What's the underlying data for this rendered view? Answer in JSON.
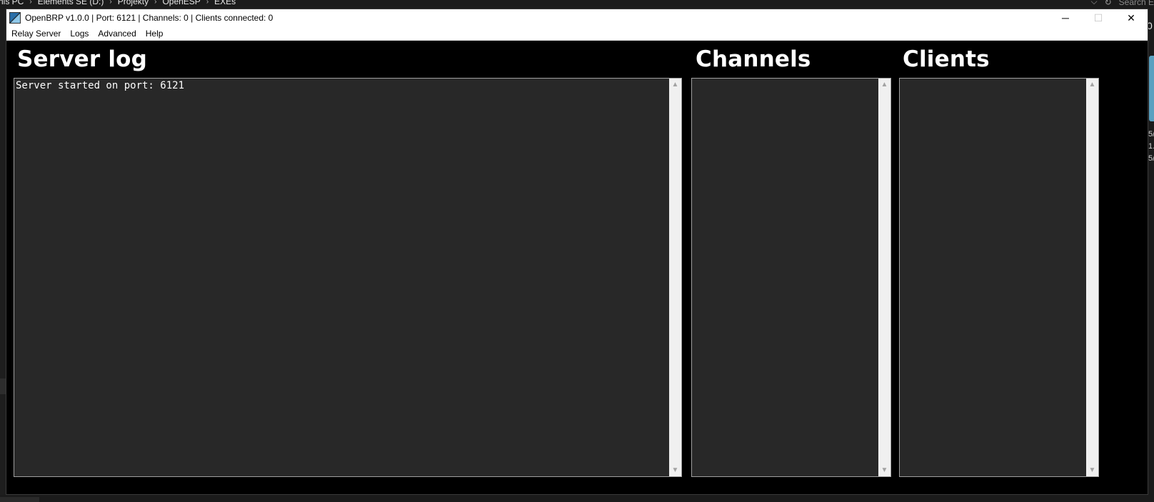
{
  "background": {
    "breadcrumbs": [
      "his PC",
      "Elements SE (D:)",
      "Projekty",
      "OpenESP",
      "EXEs"
    ],
    "search_placeholder": "Search E",
    "edge_letter": "0",
    "edge_texts": [
      "5/",
      "1.",
      "5/"
    ]
  },
  "window": {
    "title": "OpenBRP v1.0.0 | Port: 6121 | Channels: 0 | Clients connected: 0",
    "minimize": "─",
    "maximize": "☐",
    "close": "✕"
  },
  "menu": {
    "items": [
      "Relay Server",
      "Logs",
      "Advanced",
      "Help"
    ]
  },
  "sections": {
    "server_log": {
      "title": "Server log",
      "lines": [
        "Server started on port: 6121"
      ]
    },
    "channels": {
      "title": "Channels",
      "lines": []
    },
    "clients": {
      "title": "Clients",
      "lines": []
    }
  },
  "scroll": {
    "up": "▲",
    "down": "▼"
  },
  "colors": {
    "window_bg": "#000000",
    "panel_bg": "#282828",
    "title_text": "#ffffff"
  }
}
